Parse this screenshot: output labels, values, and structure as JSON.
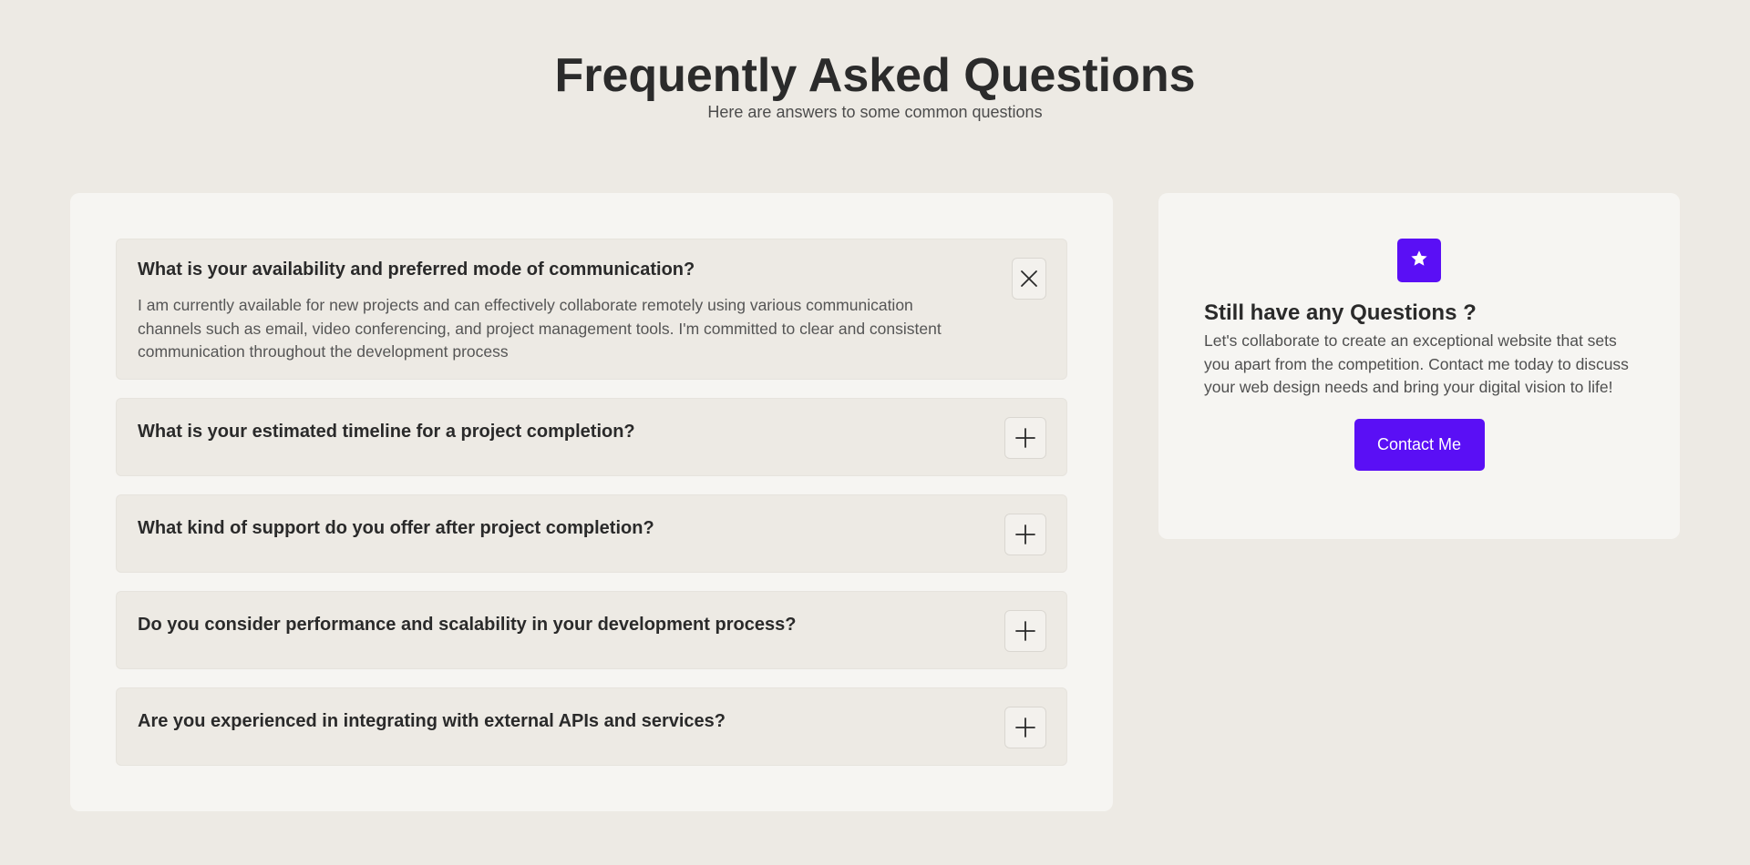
{
  "header": {
    "title": "Frequently Asked Questions",
    "subtitle": "Here are answers to some common questions"
  },
  "faq": {
    "items": [
      {
        "question": "What is your availability and preferred mode of communication?",
        "answer": "I am currently available for new projects and can effectively collaborate remotely using various communication channels such as email, video conferencing, and project management tools. I'm committed to clear and consistent communication throughout the development process",
        "state": "open",
        "toggle_icon": "close-icon"
      },
      {
        "question": "What is your estimated timeline for a project completion?",
        "state": "collapsed",
        "toggle_icon": "plus-icon"
      },
      {
        "question": "What kind of support do you offer after project completion?",
        "state": "collapsed",
        "toggle_icon": "plus-icon"
      },
      {
        "question": "Do you consider performance and scalability in your development process?",
        "state": "collapsed",
        "toggle_icon": "plus-icon"
      },
      {
        "question": "Are you experienced in integrating with external APIs and services?",
        "state": "collapsed",
        "toggle_icon": "plus-icon"
      }
    ]
  },
  "contact": {
    "icon": "star-icon",
    "title": "Still have any Questions ?",
    "text": "Let's collaborate to create an exceptional website that sets you apart from the competition. Contact me today to discuss your web design needs and bring your digital vision to life!",
    "button_label": "Contact Me"
  },
  "colors": {
    "background": "#edeae4",
    "card": "#f6f5f2",
    "accent": "#5a0ff5"
  }
}
